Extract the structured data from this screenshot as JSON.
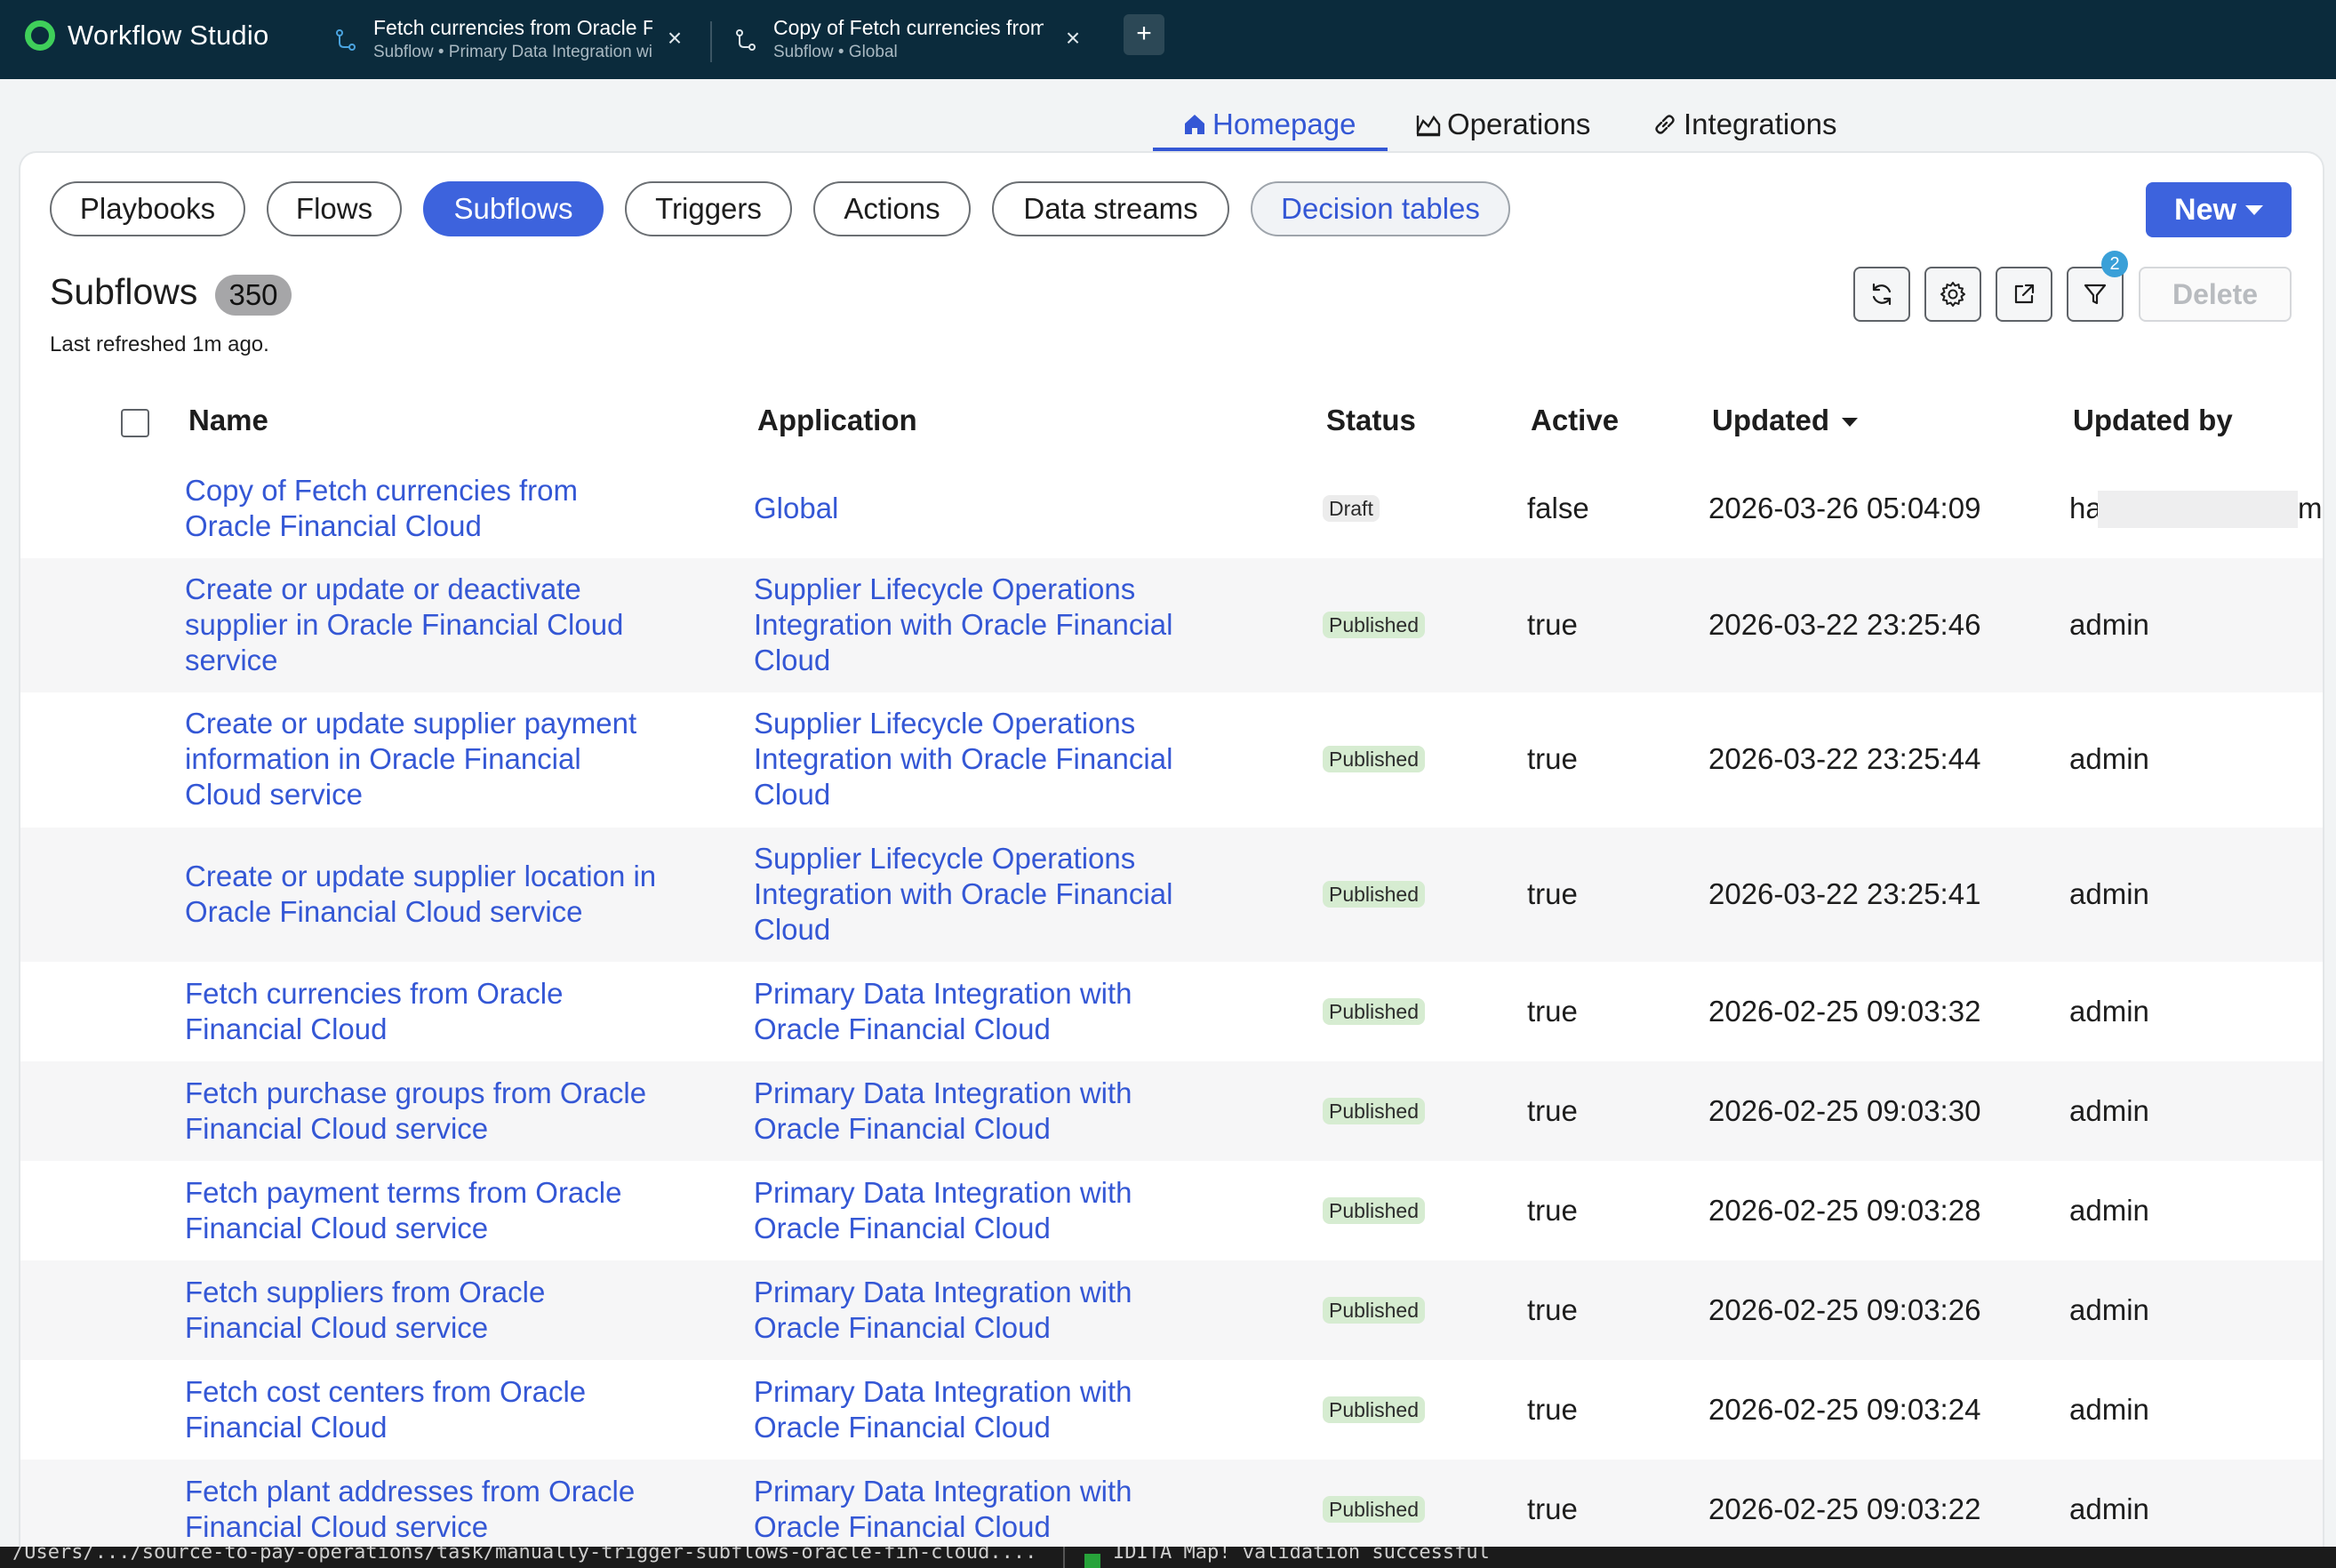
{
  "app": {
    "title": "Workflow Studio"
  },
  "window_tabs": [
    {
      "title": "Fetch currencies from Oracle Financial Cloud",
      "subtitle": "Subflow • Primary Data Integration with Oracle Financial Cloud"
    },
    {
      "title": "Copy of Fetch currencies from Oracle Financial Cloud",
      "subtitle": "Subflow • Global"
    }
  ],
  "nav_tabs": [
    {
      "label": "Homepage",
      "icon": "home-icon",
      "active": true
    },
    {
      "label": "Operations",
      "icon": "chart-icon",
      "active": false
    },
    {
      "label": "Integrations",
      "icon": "link-icon",
      "active": false
    }
  ],
  "categories": [
    {
      "label": "Playbooks"
    },
    {
      "label": "Flows"
    },
    {
      "label": "Subflows",
      "active": true
    },
    {
      "label": "Triggers"
    },
    {
      "label": "Actions"
    },
    {
      "label": "Data streams"
    },
    {
      "label": "Decision tables"
    }
  ],
  "toolbar": {
    "new_label": "New",
    "delete_label": "Delete",
    "filter_count": "2",
    "icons": [
      "refresh-icon",
      "settings-icon",
      "export-icon",
      "filter-icon"
    ]
  },
  "list": {
    "title": "Subflows",
    "count": "350",
    "last_refreshed": "Last refreshed 1m ago."
  },
  "table": {
    "columns": [
      "Name",
      "Application",
      "Status",
      "Active",
      "Updated",
      "Updated by"
    ],
    "sorted_column": "Updated",
    "rows": [
      {
        "name": "Copy of Fetch currencies from Oracle Financial Cloud",
        "application": "Global",
        "status": "Draft",
        "active": "false",
        "updated": "2026-03-26 05:04:09",
        "updated_by_start": "ha",
        "updated_by_end": "m"
      },
      {
        "name": "Create or update or deactivate supplier in Oracle Financial Cloud service",
        "application": "Supplier Lifecycle Operations Integration with Oracle Financial Cloud",
        "status": "Published",
        "active": "true",
        "updated": "2026-03-22 23:25:46",
        "updated_by": "admin"
      },
      {
        "name": "Create or update supplier payment information in Oracle Financial Cloud service",
        "application": "Supplier Lifecycle Operations Integration with Oracle Financial Cloud",
        "status": "Published",
        "active": "true",
        "updated": "2026-03-22 23:25:44",
        "updated_by": "admin"
      },
      {
        "name": "Create or update supplier location in Oracle Financial Cloud service",
        "application": "Supplier Lifecycle Operations Integration with Oracle Financial Cloud",
        "status": "Published",
        "active": "true",
        "updated": "2026-03-22 23:25:41",
        "updated_by": "admin"
      },
      {
        "name": "Fetch currencies from Oracle Financial Cloud",
        "application": "Primary Data Integration with Oracle Financial Cloud",
        "status": "Published",
        "active": "true",
        "updated": "2026-02-25 09:03:32",
        "updated_by": "admin"
      },
      {
        "name": "Fetch purchase groups from Oracle Financial Cloud service",
        "application": "Primary Data Integration with Oracle Financial Cloud",
        "status": "Published",
        "active": "true",
        "updated": "2026-02-25 09:03:30",
        "updated_by": "admin"
      },
      {
        "name": "Fetch payment terms from Oracle Financial Cloud service",
        "application": "Primary Data Integration with Oracle Financial Cloud",
        "status": "Published",
        "active": "true",
        "updated": "2026-02-25 09:03:28",
        "updated_by": "admin"
      },
      {
        "name": "Fetch suppliers from Oracle Financial Cloud service",
        "application": "Primary Data Integration with Oracle Financial Cloud",
        "status": "Published",
        "active": "true",
        "updated": "2026-02-25 09:03:26",
        "updated_by": "admin"
      },
      {
        "name": "Fetch cost centers from Oracle Financial Cloud",
        "application": "Primary Data Integration with Oracle Financial Cloud",
        "status": "Published",
        "active": "true",
        "updated": "2026-02-25 09:03:24",
        "updated_by": "admin"
      },
      {
        "name": "Fetch plant addresses from Oracle Financial Cloud service",
        "application": "Primary Data Integration with Oracle Financial Cloud",
        "status": "Published",
        "active": "true",
        "updated": "2026-02-25 09:03:22",
        "updated_by": "admin"
      }
    ]
  },
  "status_bar": {
    "path": "/Users/.../source-to-pay-operations/task/manually-trigger-subflows-oracle-fin-cloud....",
    "message": "IDITA Map! validation successful"
  },
  "colors": {
    "topbar": "#0b2b3c",
    "accent": "#3d63dd",
    "link": "#3457d5",
    "published_badge": "#d6ecd1",
    "draft_badge": "#ececec"
  }
}
